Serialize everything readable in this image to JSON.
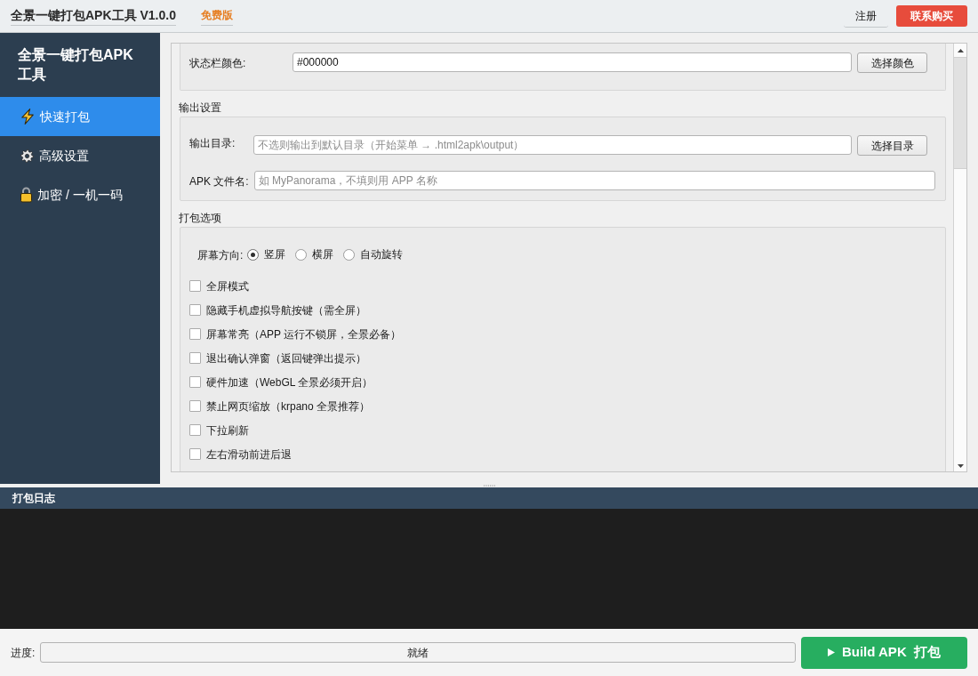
{
  "window": {
    "title": "全景一键打包APK工具 V1.0.0",
    "edition": "免费版"
  },
  "header_buttons": [
    {
      "label": "注册",
      "kind": "flat"
    },
    {
      "label": "联系购买",
      "kind": "accent"
    }
  ],
  "sidebar": {
    "title": "全景一键打包APK工具",
    "items": [
      {
        "label": "快速打包",
        "selected": true
      },
      {
        "label": "高级设置",
        "selected": false
      },
      {
        "label": "加密 / 一机一码",
        "selected": false
      }
    ]
  },
  "status_bar_color": {
    "label": "状态栏颜色:",
    "value": "#000000",
    "button": "选择颜色"
  },
  "output_settings": {
    "heading": "输出设置",
    "fields": [
      {
        "label": "输出目录:",
        "placeholder": "不选则输出到默认目录（开始菜单 → .html2apk\\output）",
        "button": "选择目录"
      },
      {
        "label": "APK 文件名:",
        "placeholder": "如 MyPanorama，不填则用 APP 名称"
      }
    ]
  },
  "build_options": {
    "heading": "打包选项",
    "orientation": {
      "label": "屏幕方向:",
      "choices": [
        {
          "label": "竖屏",
          "selected": true
        },
        {
          "label": "横屏",
          "selected": false
        },
        {
          "label": "自动旋转",
          "selected": false
        }
      ]
    },
    "checkboxes": [
      {
        "label": "全屏模式",
        "checked": false
      },
      {
        "label": "隐藏手机虚拟导航按键（需全屏）",
        "checked": false
      },
      {
        "label": "屏幕常亮（APP 运行不锁屏，全景必备）",
        "checked": false
      },
      {
        "label": "退出确认弹窗（返回键弹出提示）",
        "checked": false
      },
      {
        "label": "硬件加速（WebGL 全景必须开启）",
        "checked": false
      },
      {
        "label": "禁止网页缩放（krpano 全景推荐）",
        "checked": false
      },
      {
        "label": "下拉刷新",
        "checked": false
      },
      {
        "label": "左右滑动前进后退",
        "checked": false
      }
    ]
  },
  "log": {
    "title": "打包日志"
  },
  "footer": {
    "progress": {
      "label": "进度:",
      "level": 0,
      "text": "就绪"
    },
    "build_button": "Build APK  打包"
  }
}
